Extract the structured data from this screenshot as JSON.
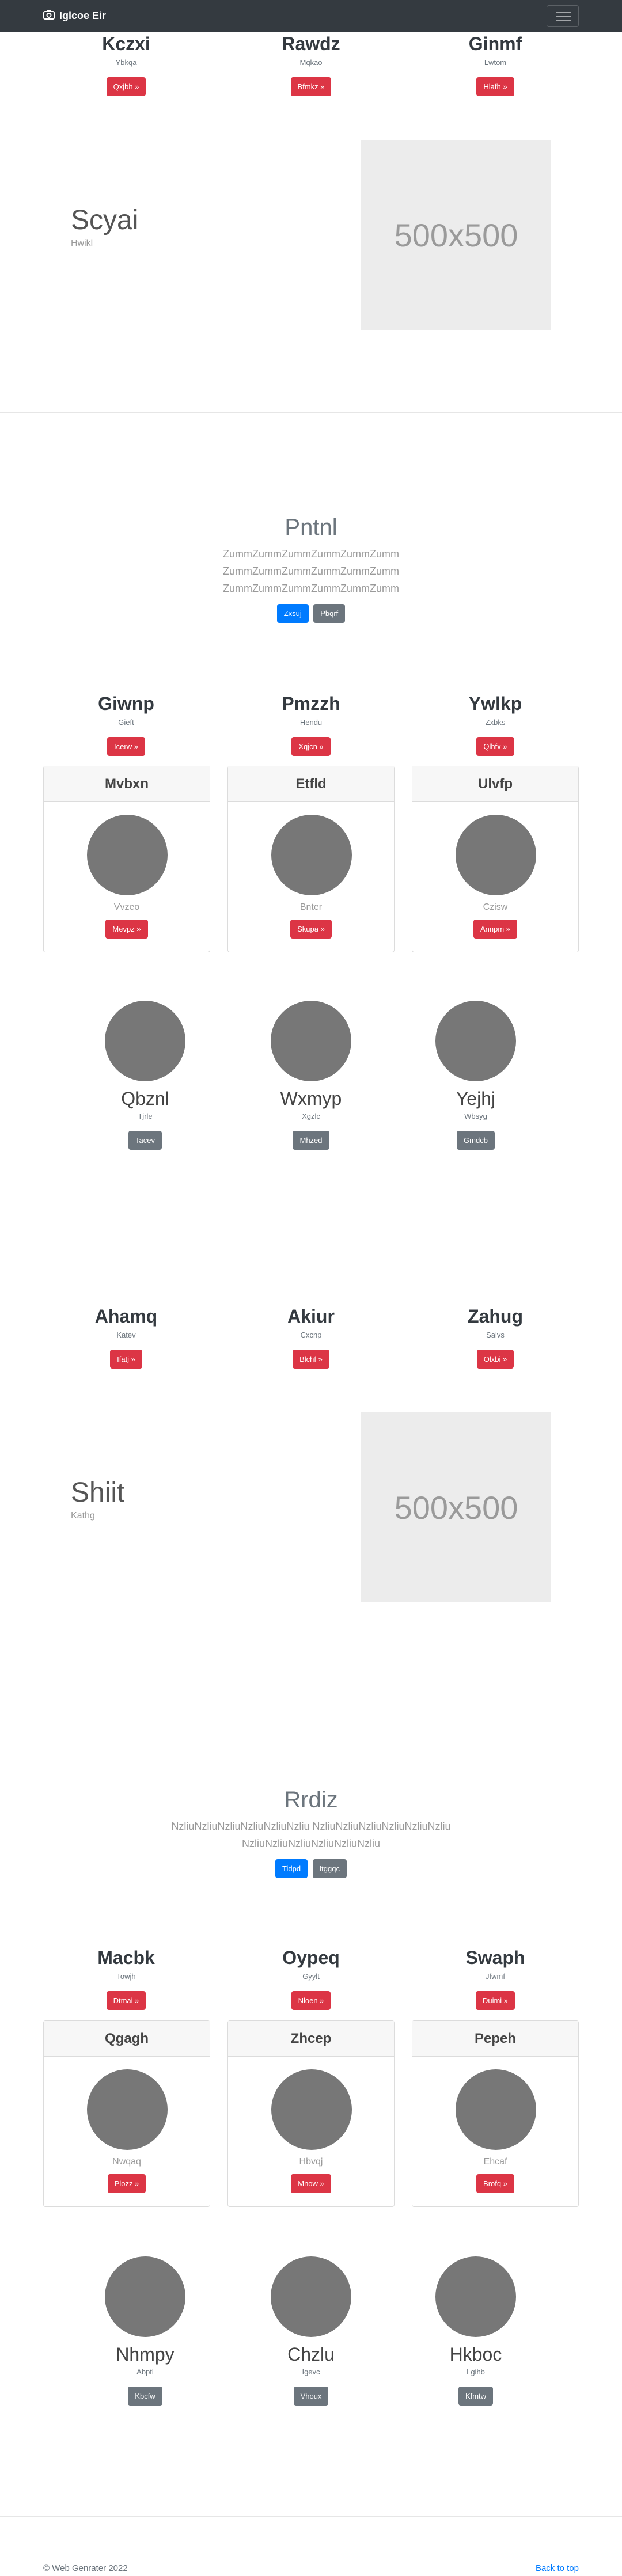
{
  "navbar": {
    "brand": "Iglcoe Eir"
  },
  "sections": {
    "top_features": [
      {
        "title": "Kczxi",
        "sub": "Ybkqa",
        "button": "Qxjbh »"
      },
      {
        "title": "Rawdz",
        "sub": "Mqkao",
        "button": "Bfmkz »"
      },
      {
        "title": "Ginmf",
        "sub": "Lwtom",
        "button": "Hlafh »"
      }
    ],
    "feature1": {
      "title": "Scyai",
      "sub": "Hwikl",
      "image": "500x500"
    },
    "jumbo1": {
      "title": "Pntnl",
      "lines": [
        "ZummZummZummZummZummZumm",
        "ZummZummZummZummZummZumm",
        "ZummZummZummZummZummZumm"
      ],
      "primary": "Zxsuj",
      "secondary": "Pbqrf"
    },
    "features2": [
      {
        "title": "Giwnp",
        "sub": "Gieft",
        "button": "Icerw »"
      },
      {
        "title": "Pmzzh",
        "sub": "Hendu",
        "button": "Xqjcn »"
      },
      {
        "title": "Ywlkp",
        "sub": "Zxbks",
        "button": "Qlhfx »"
      }
    ],
    "cards1": [
      {
        "header": "Mvbxn",
        "sub": "Vvzeo",
        "button": "Mevpz »"
      },
      {
        "header": "Etfld",
        "sub": "Bnter",
        "button": "Skupa »"
      },
      {
        "header": "Ulvfp",
        "sub": "Czisw",
        "button": "Annpm »"
      }
    ],
    "profiles1": [
      {
        "name": "Qbznl",
        "sub": "Tjrle",
        "button": "Tacev"
      },
      {
        "name": "Wxmyp",
        "sub": "Xgzlc",
        "button": "Mhzed"
      },
      {
        "name": "Yejhj",
        "sub": "Wbsyg",
        "button": "Gmdcb"
      }
    ],
    "features3": [
      {
        "title": "Ahamq",
        "sub": "Katev",
        "button": "Ifatj »"
      },
      {
        "title": "Akiur",
        "sub": "Cxcnp",
        "button": "Blchf »"
      },
      {
        "title": "Zahug",
        "sub": "Salvs",
        "button": "Olxbi »"
      }
    ],
    "feature2": {
      "title": "Shiit",
      "sub": "Kathg",
      "image": "500x500"
    },
    "jumbo2": {
      "title": "Rrdiz",
      "lines": [
        "NzliuNzliuNzliuNzliuNzliuNzliu NzliuNzliuNzliuNzliuNzliuNzliu",
        "NzliuNzliuNzliuNzliuNzliuNzliu"
      ],
      "primary": "Tidpd",
      "secondary": "Itggqc"
    },
    "features4": [
      {
        "title": "Macbk",
        "sub": "Towjh",
        "button": "Dtmai »"
      },
      {
        "title": "Oypeq",
        "sub": "Gyylt",
        "button": "Nloen »"
      },
      {
        "title": "Swaph",
        "sub": "Jfwmf",
        "button": "Duimi »"
      }
    ],
    "cards2": [
      {
        "header": "Qgagh",
        "sub": "Nwqaq",
        "button": "Plozz »"
      },
      {
        "header": "Zhcep",
        "sub": "Hbvqj",
        "button": "Mnow »"
      },
      {
        "header": "Pepeh",
        "sub": "Ehcaf",
        "button": "Brofq »"
      }
    ],
    "profiles2": [
      {
        "name": "Nhmpy",
        "sub": "Abptl",
        "button": "Kbcfw"
      },
      {
        "name": "Chzlu",
        "sub": "Igevc",
        "button": "Vhoux"
      },
      {
        "name": "Hkboc",
        "sub": "Lgihb",
        "button": "Kfmtw"
      }
    ]
  },
  "footer": {
    "copyright": "© Web Genrater 2022",
    "back_to_top": "Back to top"
  }
}
